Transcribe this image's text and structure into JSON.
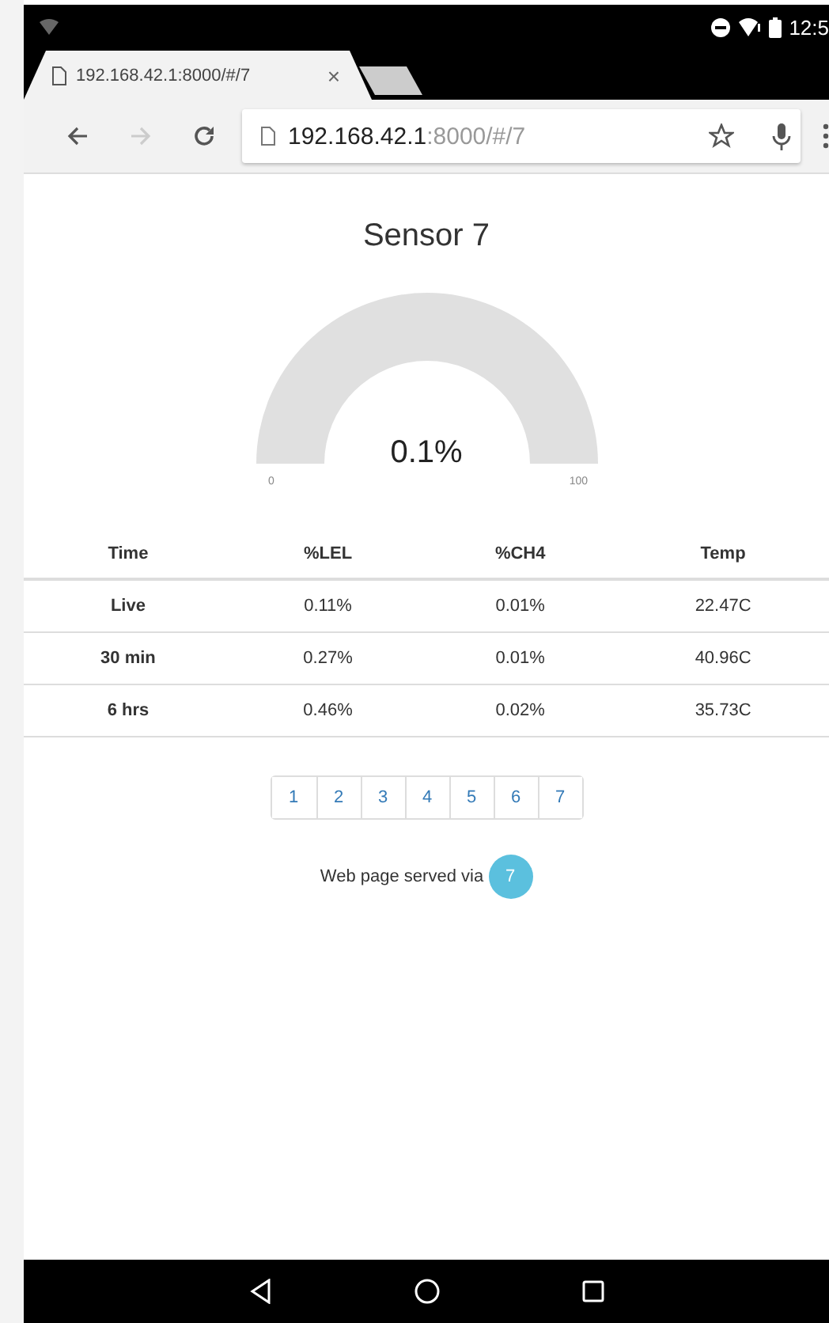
{
  "status_bar": {
    "time": "12:5"
  },
  "browser": {
    "tab_title": "192.168.42.1:8000/#/7",
    "close": "×",
    "url_host": "192.168.42.1",
    "url_rest": ":8000/#/7"
  },
  "page": {
    "title": "Sensor 7",
    "gauge": {
      "value": "0.1%",
      "min": "0",
      "max": "100"
    },
    "table": {
      "columns": [
        "Time",
        "%LEL",
        "%CH4",
        "Temp"
      ],
      "rows": [
        {
          "cells": [
            "Live",
            "0.11%",
            "0.01%",
            "22.47C"
          ]
        },
        {
          "cells": [
            "30 min",
            "0.27%",
            "0.01%",
            "40.96C"
          ]
        },
        {
          "cells": [
            "6 hrs",
            "0.46%",
            "0.02%",
            "35.73C"
          ]
        }
      ]
    },
    "pagination": [
      "1",
      "2",
      "3",
      "4",
      "5",
      "6",
      "7"
    ],
    "footer": {
      "text": "Web page served via",
      "badge": "7"
    }
  }
}
